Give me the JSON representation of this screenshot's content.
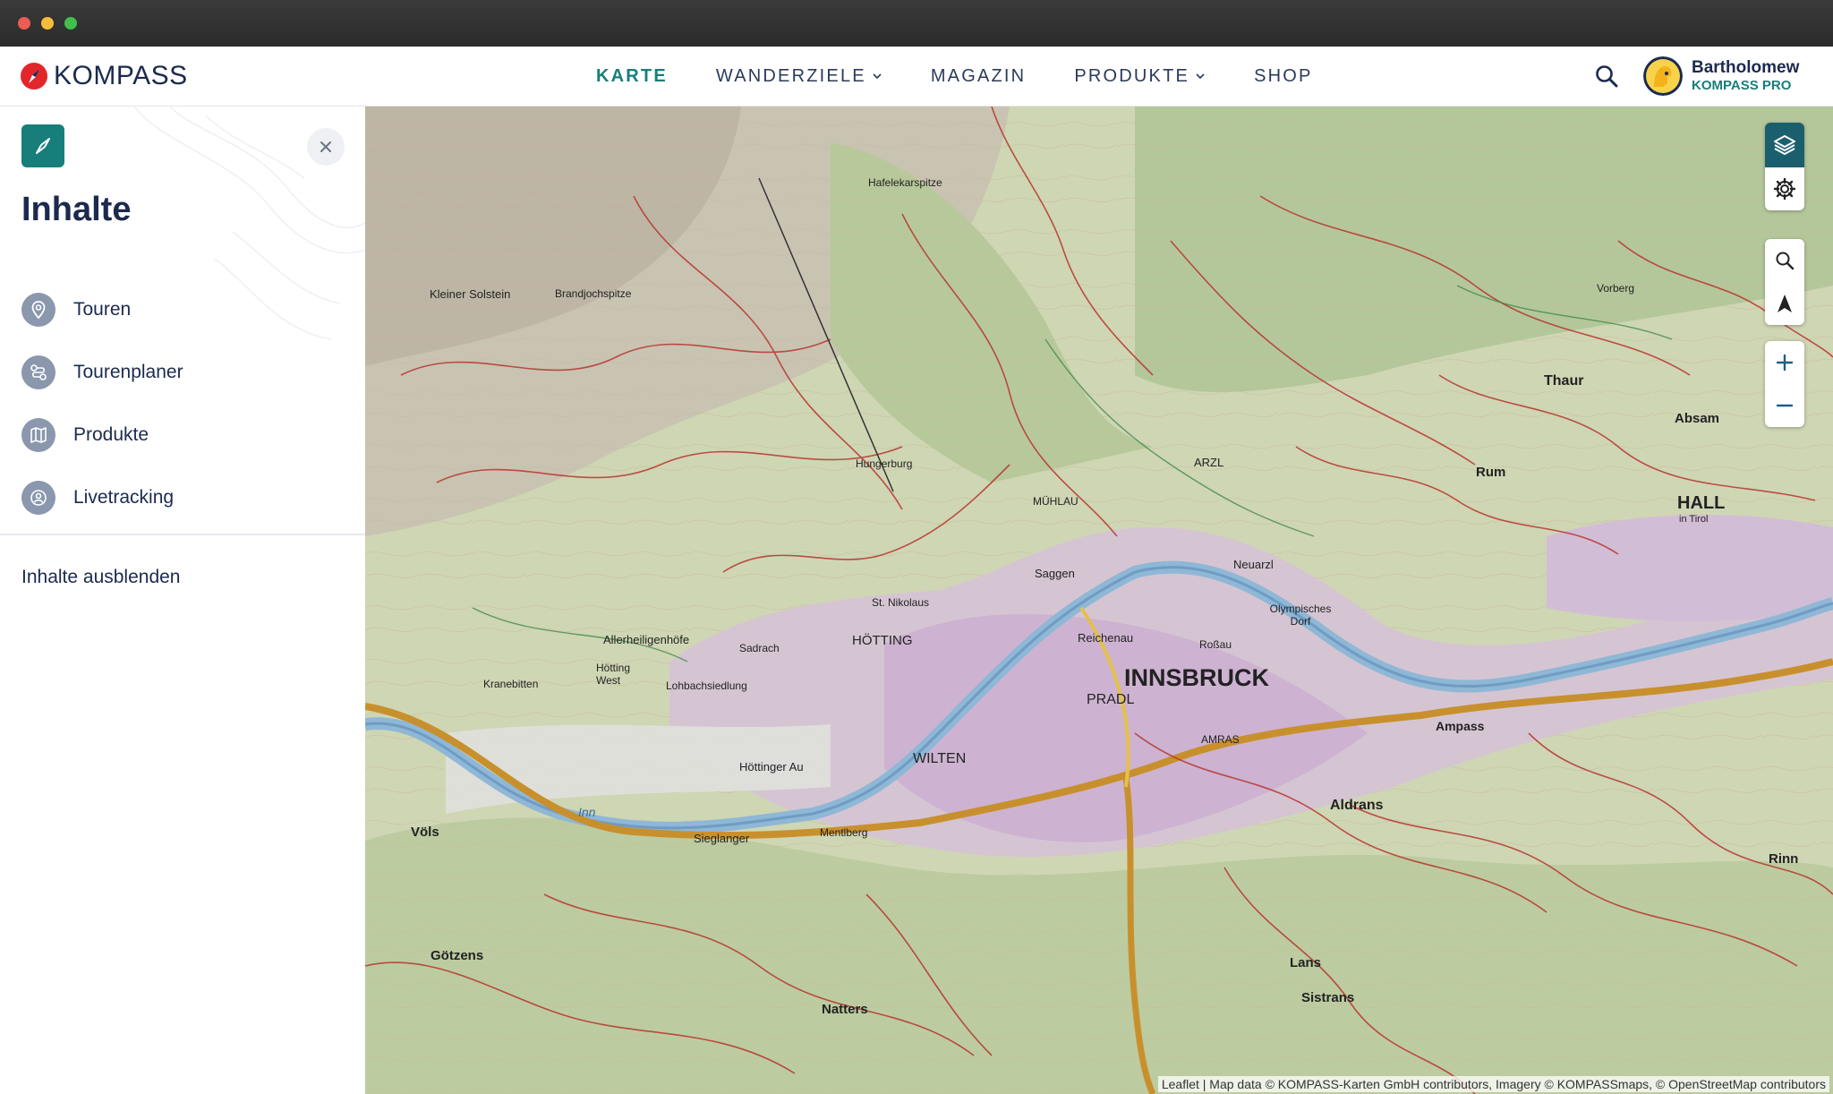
{
  "brand": {
    "name": "KOMPASS",
    "accent": "#177e7c",
    "dark": "#1b2a4e"
  },
  "nav": {
    "items": [
      {
        "label": "KARTE",
        "active": true
      },
      {
        "label": "WANDERZIELE",
        "dropdown": true
      },
      {
        "label": "MAGAZIN"
      },
      {
        "label": "PRODUKTE",
        "dropdown": true
      },
      {
        "label": "SHOP"
      }
    ]
  },
  "user": {
    "name": "Bartholomew",
    "badge": "KOMPASS PRO"
  },
  "sidebar": {
    "title": "Inhalte",
    "items": [
      {
        "label": "Touren",
        "icon": "map-pin-icon"
      },
      {
        "label": "Tourenplaner",
        "icon": "route-icon"
      },
      {
        "label": "Produkte",
        "icon": "book-map-icon"
      },
      {
        "label": "Livetracking",
        "icon": "live-tracking-icon"
      }
    ],
    "hide_label": "Inhalte ausblenden"
  },
  "map": {
    "labels": {
      "innsbruck": "INNSBRUCK",
      "hall": "HALL",
      "hall_sub": "in Tirol",
      "thaur": "Thaur",
      "absam": "Absam",
      "rum": "Rum",
      "hotting": "HÖTTING",
      "pradl": "PRADL",
      "wilten": "WILTEN",
      "arzl": "ARZL",
      "muhlau": "MÜHLAU",
      "saggen": "Saggen",
      "reichenau": "Reichenau",
      "amras": "AMRAS",
      "ampass": "Ampass",
      "aldrans": "Aldrans",
      "lans": "Lans",
      "sistrans": "Sistrans",
      "natters": "Natters",
      "gotzens": "Götzens",
      "vols": "Völs",
      "rinn": "Rinn",
      "hafelekarspitze": "Hafelekarspitze",
      "kleiner_solstein": "Kleiner Solstein",
      "brandjochspitze": "Brandjochspitze",
      "st_nikolaus": "St. Nikolaus",
      "hungerburg": "Hungerburg",
      "allerheiligenhofe": "Allerheiligenhöfe",
      "hottinger_au": "Höttinger Au",
      "sieglanger": "Sieglanger",
      "mentlberg": "Mentlberg",
      "olympisches_dorf": "Olympisches Dorf",
      "neuarzl": "Neuarzl",
      "rossau": "Roßau",
      "lohbach": "Lohbachsiedlung",
      "hotting_west": "Hötting West",
      "kranebitten": "Kranebitten",
      "inn": "Inn",
      "sadrach": "Sadrach",
      "vorberg": "Vorberg"
    },
    "attribution": "Leaflet | Map data © KOMPASS-Karten GmbH contributors, Imagery © KOMPASSmaps, © OpenStreetMap contributors"
  },
  "map_controls": [
    "layers-icon",
    "settings-gear-icon",
    "search-icon",
    "locate-arrow-icon",
    "zoom-in-icon",
    "zoom-out-icon"
  ]
}
